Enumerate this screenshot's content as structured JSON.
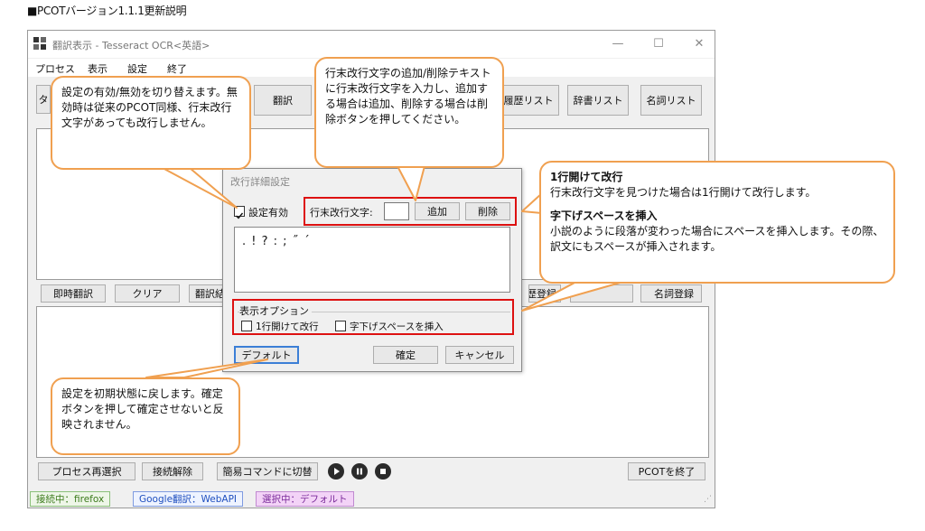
{
  "heading": "■PCOTバージョン1.1.1更新説明",
  "window": {
    "title": "翻訳表示 - Tesseract OCR<英語>",
    "controls": {
      "minimize": "—",
      "maximize": "☐",
      "close": "✕"
    }
  },
  "menu": [
    "プロセス",
    "表示",
    "設定",
    "終了"
  ],
  "toolbar": {
    "left_partial": "タ",
    "translate": "翻訳",
    "history": "履歴リスト",
    "dictionary": "辞書リスト",
    "nouns": "名詞リスト"
  },
  "middle_row": {
    "instant": "即時翻訳",
    "clear": "クリア",
    "translate_result_partial": "翻訳結",
    "history_register_partial": "歴登録",
    "noun_register_partial": "名詞登録"
  },
  "bottom_row": {
    "reselect": "プロセス再選択",
    "disconnect": "接続解除",
    "simple_cmd": "簡易コマンドに切替",
    "exit": "PCOTを終了"
  },
  "status": {
    "connected": "接続中：firefox",
    "engine": "Google翻訳：WebAPI",
    "selected": "選択中：デフォルト",
    "colors": {
      "connected": "#3a7a1a",
      "engine": "#1f4fbf",
      "selected": "#7a2a9a",
      "selected_bg": "#f3d3f7"
    }
  },
  "dialog": {
    "title": "改行詳細設定",
    "enabled_label": "設定有効",
    "enabled_checked": true,
    "eol_label": "行末改行文字:",
    "eol_input": "",
    "add": "追加",
    "delete": "削除",
    "chars": ". ! ? : ; ˝ ´",
    "options_legend": "表示オプション",
    "opt1": "1行開けて改行",
    "opt2": "字下げスペースを挿入",
    "default": "デフォルト",
    "ok": "確定",
    "cancel": "キャンセル"
  },
  "callouts": {
    "enable": "設定の有効/無効を切り替えます。無効時は従来のPCOT同様、行末改行文字があっても改行しません。",
    "eol": "行末改行文字の追加/削除テキストに行末改行文字を入力し、追加する場合は追加、削除する場合は削除ボタンを押してください。",
    "options_title1": "1行開けて改行",
    "options_text1": "行末改行文字を見つけた場合は1行開けて改行します。",
    "options_title2": "字下げスペースを挿入",
    "options_text2": "小説のように段落が変わった場合にスペースを挿入します。その際、訳文にもスペースが挿入されます。",
    "default": "設定を初期状態に戻します。確定ボタンを押して確定させないと反映されません。"
  },
  "accent_colors": {
    "callout_border": "#f0a050",
    "highlight": "#dd1111"
  }
}
